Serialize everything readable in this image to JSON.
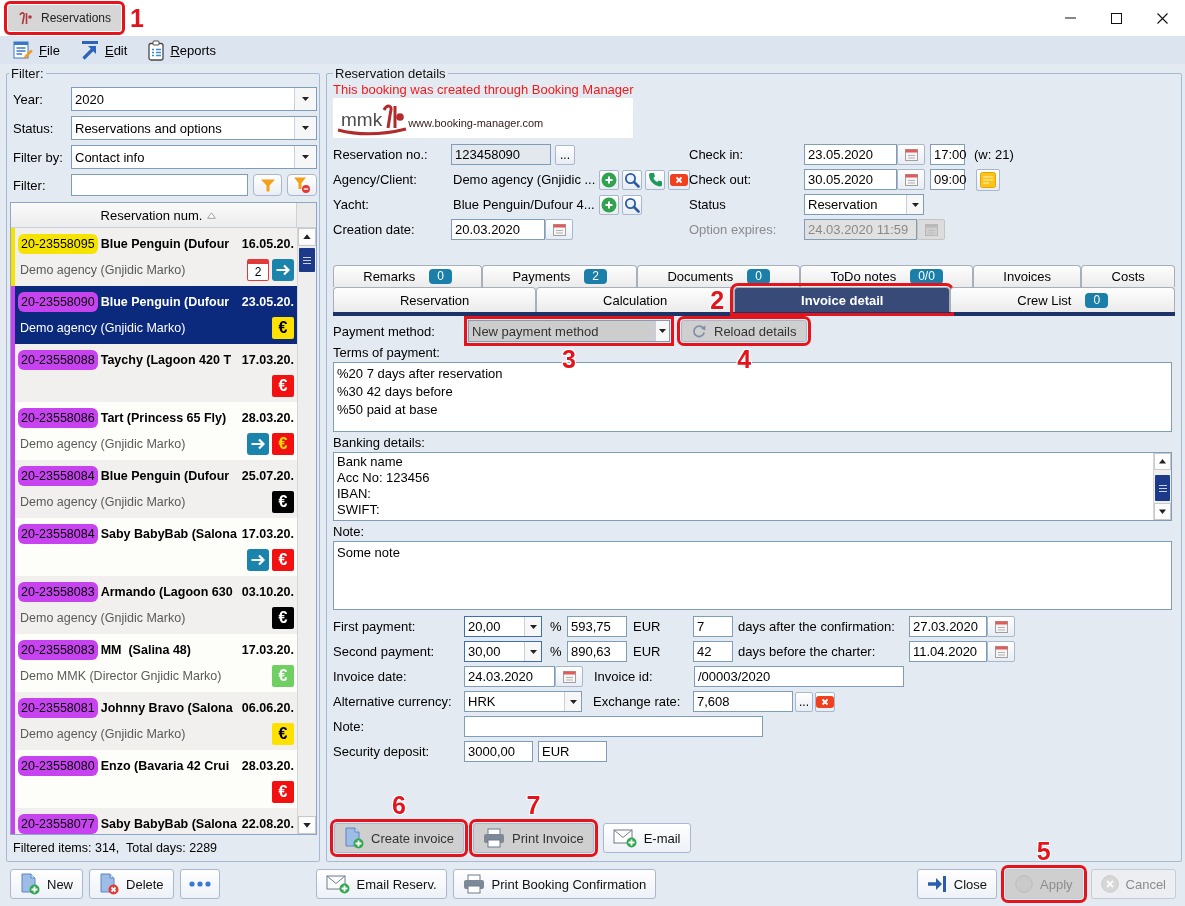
{
  "window": {
    "title": "Reservations",
    "callout": {
      "number": "1",
      "kind": "right"
    }
  },
  "menu": [
    {
      "label": "File",
      "kind": "file"
    },
    {
      "label": "Edit",
      "kind": "edit"
    },
    {
      "label": "Reports",
      "kind": "reports"
    }
  ],
  "filter": {
    "legend": "Filter:",
    "fields": [
      {
        "label": "Year:",
        "kind": "dropdown",
        "value": "2020"
      },
      {
        "label": "Status:",
        "kind": "dropdown",
        "value": "Reservations and options"
      },
      {
        "label": "Filter by:",
        "kind": "dropdown",
        "value": "Contact info"
      },
      {
        "label": "Filter:",
        "kind": "search"
      }
    ]
  },
  "reservation_list": {
    "column": "Reservation num.",
    "sorted": true,
    "rows": [
      {
        "id": "20-23558095",
        "yacht": "Blue Penguin (Dufour",
        "date": "16.05.20.",
        "client": "Demo agency (Gnjidic Marko)",
        "color": "#f5e400",
        "selected": false,
        "icons": [
          {
            "kind": "calendar",
            "label": "2"
          },
          {
            "kind": "arrow"
          }
        ]
      },
      {
        "id": "20-23558090",
        "yacht": "Blue Penguin (Dufour",
        "date": "23.05.20.",
        "client": "Demo agency (Gnjidic Marko)",
        "color": "#c843f0",
        "selected": true,
        "icons": [
          {
            "kind": "euro",
            "symbol": "€",
            "color": "#ffe100"
          }
        ]
      },
      {
        "id": "20-23558088",
        "yacht": "Taychy (Lagoon 420 T",
        "date": "17.03.20.",
        "color": "#c843f0",
        "selected": false,
        "icons": [
          {
            "kind": "euro",
            "symbol": "€",
            "color": "#f21010"
          }
        ]
      },
      {
        "id": "20-23558086",
        "yacht": "Tart (Princess 65 Fly)",
        "date": "28.03.20.",
        "client": "Demo agency (Gnjidic Marko)",
        "color": "#c843f0",
        "selected": false,
        "icons": [
          {
            "kind": "arrow"
          },
          {
            "kind": "euro_gold",
            "symbol": "€",
            "color": "#f21010"
          }
        ]
      },
      {
        "id": "20-23558084",
        "yacht": "Blue Penguin (Dufour",
        "date": "25.07.20.",
        "client": "Demo agency (Gnjidic Marko)",
        "color": "#c843f0",
        "selected": false,
        "icons": [
          {
            "kind": "euro",
            "symbol": "€",
            "color": "#000000"
          }
        ]
      },
      {
        "id": "20-23558084",
        "yacht": "Saby BabyBab (Salona",
        "date": "17.03.20.",
        "color": "#c843f0",
        "selected": false,
        "icons": [
          {
            "kind": "arrow"
          },
          {
            "kind": "euro",
            "symbol": "€",
            "color": "#f21010"
          }
        ]
      },
      {
        "id": "20-23558083",
        "yacht": "Armando (Lagoon 630",
        "date": "03.10.20.",
        "client": "Demo agency (Gnjidic Marko)",
        "color": "#c843f0",
        "selected": false,
        "icons": [
          {
            "kind": "euro",
            "symbol": "€",
            "color": "#000000"
          }
        ]
      },
      {
        "id": "20-23558083",
        "yacht": "MM  (Salina 48)",
        "date": "17.03.20.",
        "client": "Demo MMK (Director Gnjidic Marko)",
        "color": "#c843f0",
        "selected": false,
        "icons": [
          {
            "kind": "euro",
            "symbol": "€",
            "color": "#6fcf63"
          }
        ]
      },
      {
        "id": "20-23558081",
        "yacht": "Johnny Bravo (Salona",
        "date": "06.06.20.",
        "client": "Demo agency (Gnjidic Marko)",
        "color": "#c843f0",
        "selected": false,
        "icons": [
          {
            "kind": "euro",
            "symbol": "€",
            "color": "#ffe100"
          }
        ]
      },
      {
        "id": "20-23558080",
        "yacht": "Enzo (Bavaria 42 Crui",
        "date": "28.03.20.",
        "color": "#c843f0",
        "selected": false,
        "icons": [
          {
            "kind": "euro",
            "symbol": "€",
            "color": "#f21010"
          }
        ]
      },
      {
        "id": "20-23558077",
        "yacht": "Saby BabyBab (Salona",
        "date": "22.08.20.",
        "color": "#c843f0",
        "selected": false
      }
    ],
    "summary": "Filtered items: 314,  Total days: 2289"
  },
  "details": {
    "legend": "Reservation details",
    "notice": "This booking was created through Booking Manager",
    "logo": {
      "wordmark": "mmk",
      "url": "www.booking-manager.com"
    },
    "left_fields": [
      {
        "label": "Reservation no.:",
        "kind": "readonly",
        "value": "123458090",
        "actions": [
          {
            "kind": "more",
            "label": "..."
          }
        ]
      },
      {
        "label": "Agency/Client:",
        "kind": "text",
        "value": "Demo agency (Gnjidic ...",
        "actions": [
          {
            "kind": "add"
          },
          {
            "kind": "search"
          },
          {
            "kind": "phone"
          },
          {
            "kind": "remove"
          }
        ]
      },
      {
        "label": "Yacht:",
        "kind": "text",
        "value": "Blue Penguin/Dufour 4...",
        "actions": [
          {
            "kind": "add"
          },
          {
            "kind": "search"
          }
        ]
      },
      {
        "label": "Creation date:",
        "kind": "date",
        "value": "20.03.2020",
        "disabled": false
      }
    ],
    "right_fields": [
      {
        "label": "Check in:",
        "kind": "datetime",
        "value": "23.05.2020",
        "time": "17:00",
        "suffix": "(w: 21)"
      },
      {
        "label": "Check out:",
        "kind": "datetime",
        "value": "30.05.2020",
        "time": "09:00",
        "actions": [
          {
            "kind": "note"
          }
        ]
      },
      {
        "label": "Status",
        "kind": "dropdown",
        "value": "Reservation"
      },
      {
        "label": "Option expires:",
        "kind": "date",
        "value": "24.03.2020 11:59",
        "disabled": true
      }
    ]
  },
  "tabs": {
    "rows": [
      {
        "tabs": [
          {
            "label": "Remarks",
            "count": "0",
            "selected": false
          },
          {
            "label": "Payments",
            "count": "2",
            "selected": false
          },
          {
            "label": "Documents",
            "count": "0",
            "selected": false
          },
          {
            "label": "ToDo notes",
            "count": "0/0",
            "selected": false
          },
          {
            "label": "Invoices",
            "selected": false
          },
          {
            "label": "Costs",
            "selected": false
          }
        ]
      },
      {
        "tabs": [
          {
            "label": "Reservation",
            "selected": false
          },
          {
            "label": "Calculation",
            "selected": false
          },
          {
            "label": "Invoice detail",
            "selected": true,
            "callout": {
              "number": "2",
              "kind": "left"
            }
          },
          {
            "label": "Crew List",
            "count": "0",
            "selected": false
          }
        ]
      }
    ]
  },
  "invoice_detail": {
    "payment_method": {
      "label": "Payment method:",
      "value": "New payment method",
      "callout": {
        "number": "3",
        "kind": "below"
      }
    },
    "reload": {
      "label": "Reload details",
      "callout": {
        "number": "4",
        "kind": "below"
      }
    },
    "texts": [
      {
        "label": "Terms of payment:",
        "value": "%20 7 days after reservation\n%30 42 days before\n%50 paid at base",
        "scrollable": false
      },
      {
        "label": "Banking details:",
        "value": "Bank name\nAcc No: 123456\nIBAN:\nSWIFT:",
        "scrollable": true
      },
      {
        "label": "Note:",
        "value": "Some note",
        "scrollable": false
      }
    ],
    "payments": [
      {
        "label": "First payment:",
        "percent": "20,00",
        "percent_unit": "%",
        "amount": "593,75",
        "currency": "EUR",
        "days": "7",
        "days_label": "days after the confirmation:",
        "date": "27.03.2020"
      },
      {
        "label": "Second payment:",
        "percent": "30,00",
        "percent_unit": "%",
        "amount": "890,63",
        "currency": "EUR",
        "days": "42",
        "days_label": "days before the charter:",
        "date": "11.04.2020"
      }
    ],
    "invoice_date": {
      "label": "Invoice date:",
      "value": "24.03.2020"
    },
    "invoice_id": {
      "label": "Invoice id:",
      "value": "/00003/2020"
    },
    "currency": {
      "label": "Alternative currency:",
      "value": "HRK"
    },
    "exchange_rate": {
      "label": "Exchange rate:",
      "value": "7,608",
      "more": "..."
    },
    "note": {
      "label": "Note:"
    },
    "deposit": {
      "label": "Security deposit:",
      "amount": "3000,00",
      "currency": "EUR"
    },
    "buttons": [
      {
        "kind": "create",
        "label": "Create invoice",
        "callout": {
          "number": "6",
          "kind": "above"
        }
      },
      {
        "kind": "print",
        "label": "Print Invoice",
        "callout": {
          "number": "7",
          "kind": "above"
        }
      },
      {
        "kind": "email",
        "label": "E-mail"
      }
    ]
  },
  "bottom_bar": {
    "left": [
      {
        "kind": "new",
        "label": "New",
        "disabled": false
      },
      {
        "kind": "delete",
        "label": "Delete",
        "disabled": false
      },
      {
        "kind": "more",
        "disabled": false
      }
    ],
    "middle": [
      {
        "kind": "email",
        "label": "Email Reserv.",
        "disabled": false
      },
      {
        "kind": "print",
        "label": "Print Booking Confirmation",
        "disabled": false
      }
    ],
    "right": [
      {
        "kind": "close",
        "label": "Close",
        "disabled": false
      },
      {
        "kind": "apply",
        "label": "Apply",
        "disabled": true,
        "callout": {
          "number": "5",
          "kind": "above"
        }
      },
      {
        "kind": "cancel",
        "label": "Cancel",
        "disabled": true
      }
    ]
  }
}
